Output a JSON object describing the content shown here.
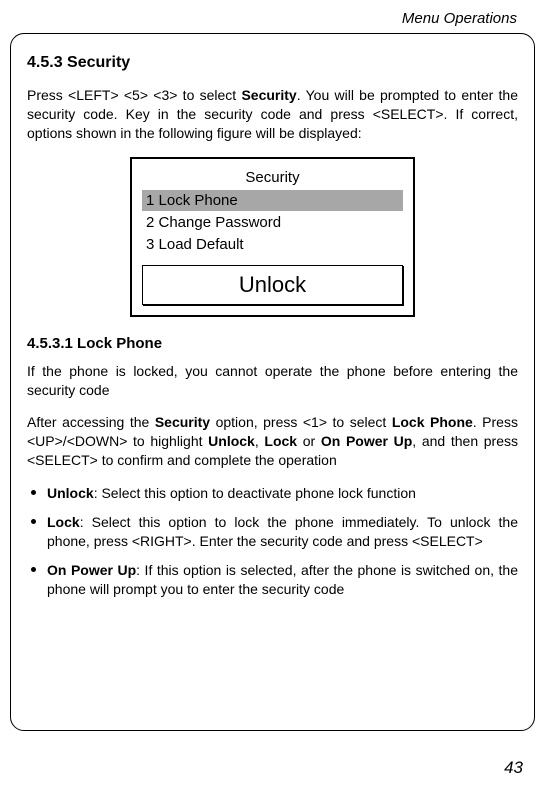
{
  "header": {
    "chapter": "Menu Operations"
  },
  "section": {
    "number": "4.5.3",
    "title": "Security",
    "heading": "4.5.3 Security"
  },
  "intro": {
    "pre": "Press <LEFT> <5> <3> to select ",
    "bold1": "Security",
    "post": ". You will be prompted to enter the security code. Key in the security code and press <SELECT>. If correct, options shown in the following figure will be displayed:"
  },
  "screen": {
    "title": "Security",
    "items": [
      {
        "label": "1 Lock Phone",
        "selected": true
      },
      {
        "label": "2 Change Password",
        "selected": false
      },
      {
        "label": "3 Load Default",
        "selected": false
      }
    ],
    "softkey": "Unlock"
  },
  "subsection": {
    "heading": "4.5.3.1 Lock Phone",
    "p1": "If the phone is locked, you cannot operate the phone before entering the security code",
    "p2_pre": "After accessing the ",
    "p2_b1": "Security",
    "p2_mid1": " option, press <1> to select ",
    "p2_b2": "Lock Phone",
    "p2_mid2": ". Press <UP>/<DOWN> to highlight ",
    "p2_b3": "Unlock",
    "p2_mid3": ", ",
    "p2_b4": "Lock",
    "p2_mid4": " or ",
    "p2_b5": "On Power Up",
    "p2_post": ", and then press <SELECT> to confirm and complete the operation"
  },
  "bullets": [
    {
      "bold": "Unlock",
      "rest": ": Select this option to deactivate phone lock function"
    },
    {
      "bold": "Lock",
      "rest": ": Select this option to lock the phone immediately. To unlock the phone, press <RIGHT>. Enter the security code and press <SELECT>"
    },
    {
      "bold": "On Power Up",
      "rest": ": If this option is selected, after the phone is switched on, the phone will prompt you to enter the security code"
    }
  ],
  "page_number": "43"
}
